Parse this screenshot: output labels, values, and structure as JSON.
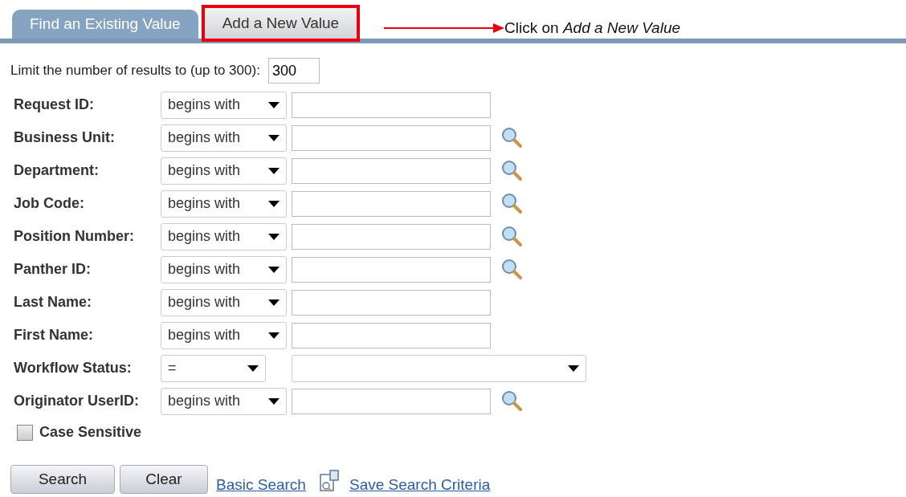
{
  "tabs": [
    {
      "label": "Find an Existing Value",
      "selected": true,
      "highlighted": false
    },
    {
      "label": "Add a New Value",
      "selected": false,
      "highlighted": true
    }
  ],
  "callout": {
    "text": "Click on *Add a New Value*"
  },
  "limit": {
    "label": "Limit the number of results to (up to 300):",
    "value": "300"
  },
  "fields": [
    {
      "kind": "text",
      "label": "Request ID:",
      "operator": "begins with",
      "lookup": false
    },
    {
      "kind": "text",
      "label": "Business Unit:",
      "operator": "begins with",
      "lookup": true
    },
    {
      "kind": "text",
      "label": "Department:",
      "operator": "begins with",
      "lookup": true
    },
    {
      "kind": "text",
      "label": "Job Code:",
      "operator": "begins with",
      "lookup": true
    },
    {
      "kind": "text",
      "label": "Position Number:",
      "operator": "begins with",
      "lookup": true
    },
    {
      "kind": "text",
      "label": "Panther ID:",
      "operator": "begins with",
      "lookup": true
    },
    {
      "kind": "text",
      "label": "Last Name:",
      "operator": "begins with",
      "lookup": false
    },
    {
      "kind": "text",
      "label": "First Name:",
      "operator": "begins with",
      "lookup": false
    },
    {
      "kind": "dropdown",
      "label": "Workflow Status:",
      "operator": "=",
      "lookup": false
    },
    {
      "kind": "text",
      "label": "Originator UserID:",
      "operator": "begins with",
      "lookup": true
    }
  ],
  "case_sensitive": {
    "label": "Case Sensitive",
    "checked": false
  },
  "buttons": [
    "Search",
    "Clear"
  ],
  "links": [
    {
      "kind": "plain",
      "label": "Basic Search"
    },
    {
      "kind": "save",
      "label": "Save Search Criteria"
    }
  ]
}
